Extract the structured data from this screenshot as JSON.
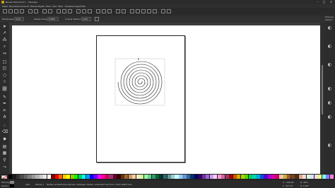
{
  "window": {
    "title": "Neues Dokument 1 - Inkscape"
  },
  "menu": [
    "Datei",
    "Bearbeiten",
    "Ansicht",
    "Ebene",
    "Objekt",
    "Pfad",
    "Text",
    "Filter",
    "Erweiterungen",
    "Hilfe"
  ],
  "tool_controls": {
    "turns_label": "Windungen:",
    "turns_value": "3,00",
    "divergence_label": "Abweichung:",
    "divergence_value": "0,829",
    "inner_radius_label": "Innerer Radius:",
    "inner_radius_value": "0,00"
  },
  "snap": {
    "line1": "Fixierung",
    "line2": "Abstand"
  },
  "palette_colors": [
    "#000000",
    "#1a1a1a",
    "#333333",
    "#4d4d4d",
    "#666666",
    "#808080",
    "#999999",
    "#b3b3b3",
    "#cccccc",
    "#e6e6e6",
    "#ffffff",
    "#800000",
    "#ff0000",
    "#ff6600",
    "#ffcc00",
    "#ffff00",
    "#99cc00",
    "#00ff00",
    "#00cc66",
    "#00ffff",
    "#0099ff",
    "#0000ff",
    "#6600ff",
    "#ff00ff",
    "#ff0099",
    "#cc0066",
    "#993366",
    "#660033",
    "#330000",
    "#663300",
    "#996633",
    "#cc9966",
    "#ffcc99",
    "#ffe6cc",
    "#ccff99",
    "#99ff99",
    "#66cc99",
    "#339966",
    "#006633",
    "#003333",
    "#336666",
    "#669999",
    "#99cccc",
    "#ccffff",
    "#99ccff",
    "#6699cc",
    "#336699",
    "#003366",
    "#000066",
    "#330066",
    "#663399",
    "#9966cc",
    "#cc99ff",
    "#ffccff",
    "#ff99cc",
    "#cc6699",
    "#993366",
    "#aa0000",
    "#d45500",
    "#d4aa00",
    "#aad400",
    "#55d400",
    "#00d455",
    "#00d4aa",
    "#00aad4",
    "#0055d4",
    "#5500d4",
    "#aa00d4",
    "#d400aa",
    "#d40055",
    "#e9c6af",
    "#c8ab37",
    "#a05a2c",
    "#784421",
    "#502d16",
    "#deaa87",
    "#f4d7d7",
    "#d7f4e3",
    "#d7e3f4",
    "#f4d7ee",
    "#e5ff80",
    "#80ffe5",
    "#8080ff",
    "#ff80e5"
  ],
  "status": {
    "fill_label": "Füllung:",
    "stroke_label": "Kontur:",
    "opacity_value": "100",
    "layer": "Ebene 1",
    "message": "Ziehen erstellt eine Spirale. Anfasser ziehen verändert die Form. Klick wählt aus.",
    "x_label": "X:",
    "x_value": "-106,93",
    "y_label": "Y:",
    "y_value": "297,47",
    "zoom_label": "Z:",
    "zoom_value": "35%",
    "rotation_label": "R:",
    "rotation_value": "0,00°"
  },
  "icons": {
    "toolbox": [
      "selector-icon",
      "node-icon",
      "tweak-icon",
      "zoom-icon",
      "measure-icon",
      "rect-icon",
      "box3d-icon",
      "ellipse-icon",
      "star-icon",
      "spiral-icon",
      "pencil-icon",
      "pen-icon",
      "calligraphy-icon",
      "text-icon",
      "spray-icon",
      "eraser-icon",
      "bucket-icon",
      "gradient-icon",
      "mesh-icon",
      "dropper-icon",
      "connector-icon"
    ],
    "right": [
      "snap-toggle-icon",
      "snap-bbox-icon",
      "snap-nodes-icon",
      "snap-page-icon",
      "snap-guide-icon",
      "snap-center-icon",
      "snap-grid-icon"
    ]
  },
  "colors": {
    "canvas": "#ffffff",
    "chrome": "#2b2b2b",
    "spiral": "#000000"
  }
}
